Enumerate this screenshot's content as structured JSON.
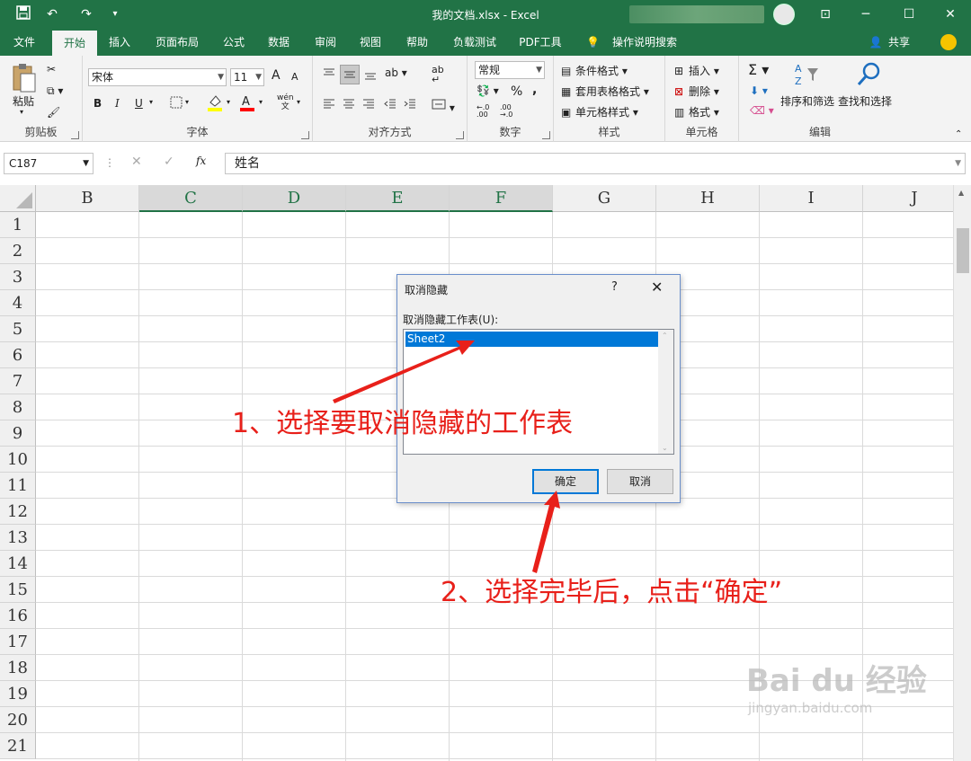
{
  "titlebar": {
    "title": "我的文档.xlsx  -  Excel",
    "minimize_glyph": "─",
    "restore_glyph": "☐",
    "close_glyph": "✕",
    "ribbon_display_glyph": "⊡"
  },
  "menu_tabs": [
    "文件",
    "开始",
    "插入",
    "页面布局",
    "公式",
    "数据",
    "审阅",
    "视图",
    "帮助",
    "负载测试",
    "PDF工具",
    "操作说明搜索"
  ],
  "share_label": "共享",
  "ribbon": {
    "clipboard": {
      "group": "剪贴板",
      "paste": "粘贴"
    },
    "font": {
      "group": "字体",
      "font_name": "宋体",
      "font_size": "11",
      "bold": "B",
      "italic": "I",
      "underline": "U",
      "grow": "A",
      "shrink": "A",
      "phonetic": "wén"
    },
    "alignment": {
      "group": "对齐方式"
    },
    "number": {
      "group": "数字",
      "format": "常规",
      "percent": "%",
      "comma": ","
    },
    "styles": {
      "group": "样式",
      "conditional": "条件格式",
      "table": "套用表格格式",
      "cell_styles": "单元格样式"
    },
    "cells": {
      "group": "单元格",
      "insert": "插入",
      "delete": "删除",
      "format": "格式"
    },
    "editing": {
      "group": "编辑",
      "sort": "排序和筛选",
      "find": "查找和选择"
    }
  },
  "formula_bar": {
    "name_box": "C187",
    "content": "姓名",
    "fx": "fx"
  },
  "grid": {
    "columns": [
      "B",
      "C",
      "D",
      "E",
      "F",
      "G",
      "H",
      "I",
      "J"
    ],
    "selected_columns": [
      "C",
      "D",
      "E",
      "F"
    ],
    "rows": [
      "1",
      "2",
      "3",
      "4",
      "5",
      "6",
      "7",
      "8",
      "9",
      "10",
      "11",
      "12",
      "13",
      "14",
      "15",
      "16",
      "17",
      "18",
      "19",
      "20",
      "21"
    ]
  },
  "dialog": {
    "title": "取消隐藏",
    "help": "?",
    "close": "✕",
    "label": "取消隐藏工作表(U):",
    "items": [
      "Sheet2"
    ],
    "ok": "确定",
    "cancel": "取消"
  },
  "annotations": {
    "step1": "1、选择要取消隐藏的工作表",
    "step2": "2、选择完毕后，点击“确定”"
  },
  "watermark": {
    "brand": "Bai du 经验",
    "url": "jingyan.baidu.com"
  },
  "colors": {
    "excel_green": "#217346",
    "accent_blue": "#0078d7",
    "annotation_red": "#e8201a"
  }
}
